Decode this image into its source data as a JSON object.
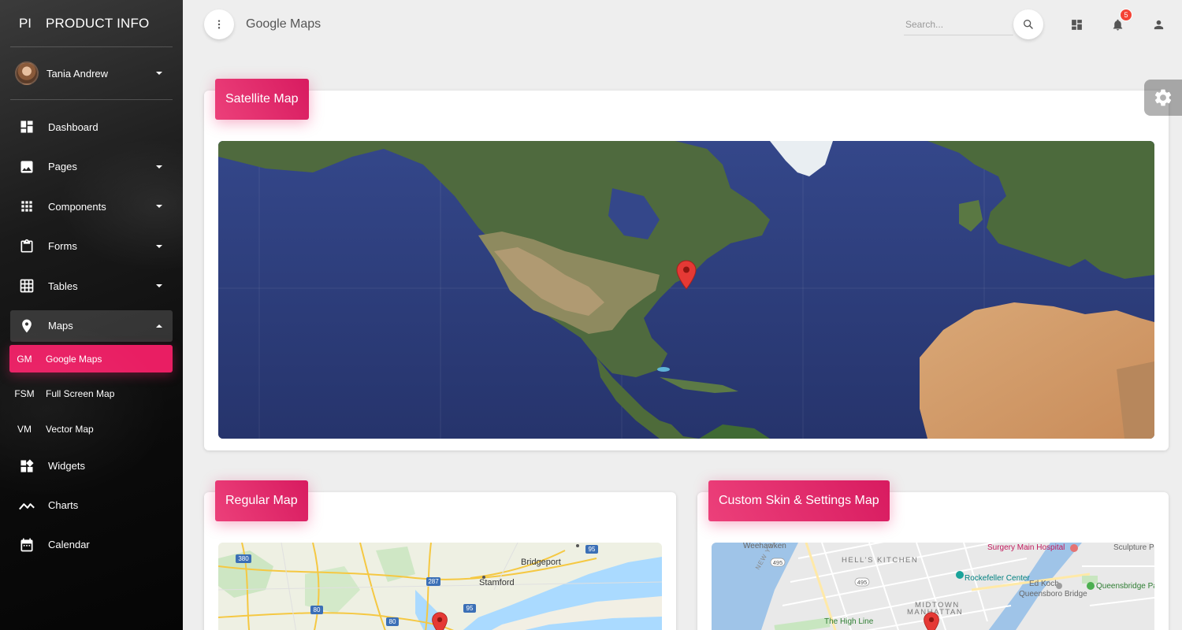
{
  "brand": {
    "mini": "PI",
    "full": "PRODUCT INFO"
  },
  "user": {
    "name": "Tania Andrew"
  },
  "sidebar": {
    "items": [
      {
        "label": "Dashboard",
        "icon": "dashboard-icon"
      },
      {
        "label": "Pages",
        "icon": "image-icon"
      },
      {
        "label": "Components",
        "icon": "apps-grid-icon"
      },
      {
        "label": "Forms",
        "icon": "clipboard-icon"
      },
      {
        "label": "Tables",
        "icon": "grid-on-icon"
      },
      {
        "label": "Maps",
        "icon": "place-icon"
      }
    ],
    "maps_sub": [
      {
        "abbr": "GM",
        "label": "Google Maps"
      },
      {
        "abbr": "FSM",
        "label": "Full Screen Map"
      },
      {
        "abbr": "VM",
        "label": "Vector Map"
      }
    ],
    "lower": [
      {
        "label": "Widgets",
        "icon": "widgets-icon"
      },
      {
        "label": "Charts",
        "icon": "timeline-icon"
      },
      {
        "label": "Calendar",
        "icon": "calendar-icon"
      }
    ]
  },
  "topbar": {
    "title": "Google Maps",
    "search_placeholder": "Search...",
    "notification_count": "5"
  },
  "cards": {
    "satellite": {
      "title": "Satellite Map"
    },
    "regular": {
      "title": "Regular Map"
    },
    "custom": {
      "title": "Custom Skin & Settings Map"
    }
  },
  "regular_map_labels": {
    "route_380": "380",
    "route_287": "287",
    "route_95": "95",
    "route_80a": "80",
    "route_80b": "80",
    "route_95b": "95",
    "bridgeport": "Bridgeport",
    "stamford": "Stamford"
  },
  "custom_map_labels": {
    "weehawken": "Weehawken",
    "surgery": "Surgery Main Hospital",
    "sculpture": "Sculpture Pa",
    "hells_kitchen": "HELL'S KITCHEN",
    "route_495a": "495",
    "route_495b": "495",
    "rockefeller": "Rockefeller Center",
    "queensbridge": "Queensbridge Park",
    "ed_koch": "Ed Koch",
    "queensboro": "Queensboro Bridge",
    "midtown": "MIDTOWN",
    "manhattan": "MANHATTAN",
    "high_line": "The High Line",
    "new_york": "NEW YORK"
  },
  "colors": {
    "accent": "#e91e63",
    "sidebar_bg": "#111111",
    "page_bg": "#eeeeee"
  }
}
